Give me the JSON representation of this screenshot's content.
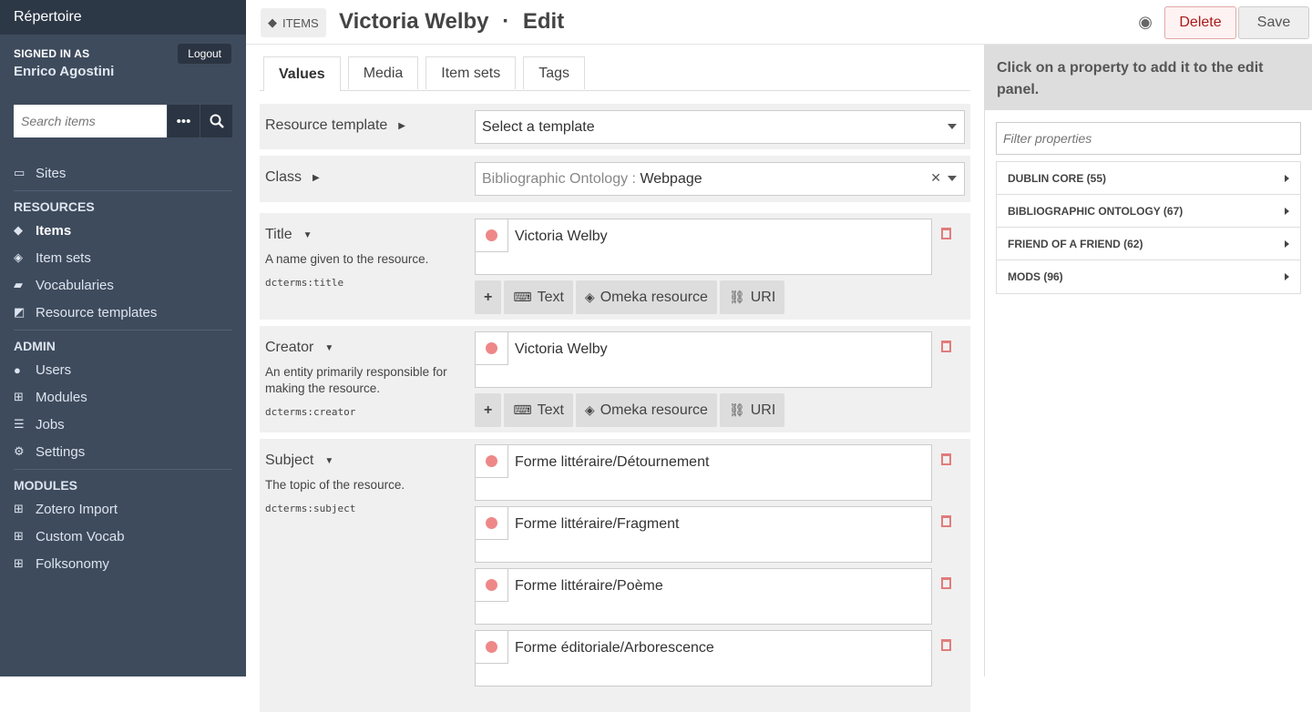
{
  "sidebar": {
    "brand": "Répertoire",
    "signed_in_label": "SIGNED IN AS",
    "user_name": "Enrico Agostini",
    "logout_label": "Logout",
    "search_placeholder": "Search items",
    "sites_label": "Sites",
    "resources_heading": "RESOURCES",
    "resources": [
      {
        "label": "Items",
        "icon": "cube-icon"
      },
      {
        "label": "Item sets",
        "icon": "cubes-icon"
      },
      {
        "label": "Vocabularies",
        "icon": "book-icon"
      },
      {
        "label": "Resource templates",
        "icon": "pencil-square-icon"
      }
    ],
    "admin_heading": "ADMIN",
    "admin": [
      {
        "label": "Users",
        "icon": "user-icon"
      },
      {
        "label": "Modules",
        "icon": "plus-square-icon"
      },
      {
        "label": "Jobs",
        "icon": "list-icon"
      },
      {
        "label": "Settings",
        "icon": "cogs-icon"
      }
    ],
    "modules_heading": "MODULES",
    "modules": [
      {
        "label": "Zotero Import"
      },
      {
        "label": "Custom Vocab"
      },
      {
        "label": "Folksonomy"
      }
    ]
  },
  "header": {
    "section_badge": "ITEMS",
    "title": "Victoria Welby",
    "separator": "·",
    "mode": "Edit",
    "delete_label": "Delete",
    "save_label": "Save"
  },
  "tabs": [
    "Values",
    "Media",
    "Item sets",
    "Tags"
  ],
  "template_row": {
    "label": "Resource template",
    "value": "Select a template"
  },
  "class_row": {
    "label": "Class",
    "vocab": "Bibliographic Ontology :",
    "value": "Webpage"
  },
  "actions": {
    "add": "+",
    "text": "Text",
    "omeka": "Omeka resource",
    "uri": "URI"
  },
  "properties": {
    "title": {
      "label": "Title",
      "desc": "A name given to the resource.",
      "term": "dcterms:title",
      "values": [
        "Victoria Welby"
      ]
    },
    "creator": {
      "label": "Creator",
      "desc": "An entity primarily responsible for making the resource.",
      "term": "dcterms:creator",
      "values": [
        "Victoria Welby"
      ]
    },
    "subject": {
      "label": "Subject",
      "desc": "The topic of the resource.",
      "term": "dcterms:subject",
      "values": [
        "Forme littéraire/Détournement",
        "Forme littéraire/Fragment",
        "Forme littéraire/Poème",
        "Forme éditoriale/Arborescence"
      ]
    }
  },
  "right_panel": {
    "heading": "Click on a property to add it to the edit panel.",
    "filter_placeholder": "Filter properties",
    "vocabularies": [
      "DUBLIN CORE (55)",
      "BIBLIOGRAPHIC ONTOLOGY (67)",
      "FRIEND OF A FRIEND (62)",
      "MODS (96)"
    ]
  }
}
